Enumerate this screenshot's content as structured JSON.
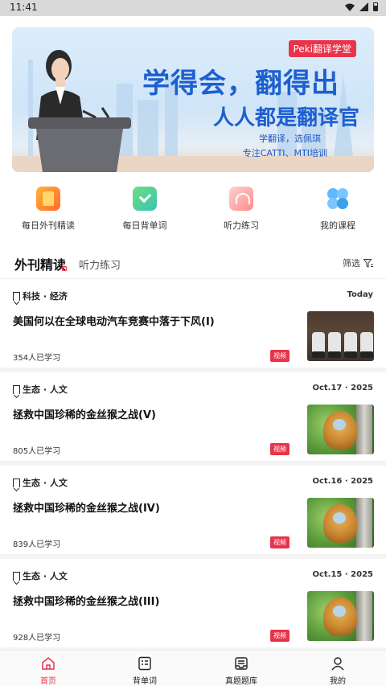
{
  "status_bar": {
    "time": "11:41",
    "icons": [
      "wifi-icon",
      "signal-icon",
      "battery-icon"
    ]
  },
  "banner": {
    "brand_tag": "Peki翻译学堂",
    "headline": "学得会，翻得出",
    "subheadline": "人人都是翻译官",
    "line1": "学翻译，选佩琪",
    "line2": "专注CATTI、MTI培训"
  },
  "quick_nav": [
    {
      "label": "每日外刊精读",
      "icon": "magazine-icon"
    },
    {
      "label": "每日背单词",
      "icon": "checkmark-calendar-icon"
    },
    {
      "label": "听力练习",
      "icon": "headphones-icon"
    },
    {
      "label": "我的课程",
      "icon": "course-icon"
    }
  ],
  "tabs": {
    "active": "外刊精读",
    "inactive": "听力练习",
    "filter": "筛选"
  },
  "articles": [
    {
      "category": "科技 · 经济",
      "date": "Today",
      "title": "美国何以在全球电动汽车竞赛中落于下风(I)",
      "count": "354人已学习",
      "tag": "视频",
      "thumb": "ev-charging-photo"
    },
    {
      "category": "生态 · 人文",
      "date": "Oct.17 · 2025",
      "title": "拯救中国珍稀的金丝猴之战(V)",
      "count": "805人已学习",
      "tag": "视频",
      "thumb": "golden-monkey-photo"
    },
    {
      "category": "生态 · 人文",
      "date": "Oct.16 · 2025",
      "title": "拯救中国珍稀的金丝猴之战(IV)",
      "count": "839人已学习",
      "tag": "视频",
      "thumb": "golden-monkey-photo"
    },
    {
      "category": "生态 · 人文",
      "date": "Oct.15 · 2025",
      "title": "拯救中国珍稀的金丝猴之战(III)",
      "count": "928人已学习",
      "tag": "视频",
      "thumb": "golden-monkey-photo"
    }
  ],
  "bottom_nav": [
    {
      "label": "首页",
      "icon": "home-icon",
      "active": true
    },
    {
      "label": "背单词",
      "icon": "vocabulary-icon",
      "active": false
    },
    {
      "label": "真题题库",
      "icon": "question-bank-icon",
      "active": false
    },
    {
      "label": "我的",
      "icon": "profile-icon",
      "active": false
    }
  ],
  "colors": {
    "accent": "#e8344a",
    "brand_blue": "#1e5fd0"
  }
}
